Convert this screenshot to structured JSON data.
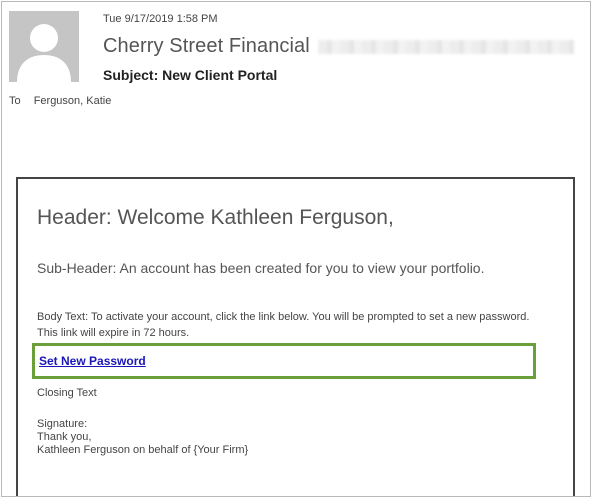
{
  "header": {
    "timestamp": "Tue 9/17/2019 1:58 PM",
    "sender_name": "Cherry Street Financial",
    "subject": "Subject: New Client Portal",
    "to_label": "To",
    "to_value": "Ferguson, Katie"
  },
  "email": {
    "header_text": "Header: Welcome Kathleen Ferguson,",
    "subheader_text": "Sub-Header: An account has been created for you to view your portfolio.",
    "body_text": "Body Text: To activate your account, click the link below. You will be prompted to set a new password. This link will expire in 72 hours.",
    "link_text": "Set New Password",
    "closing_text": "Closing Text",
    "signature": {
      "label": "Signature:",
      "line1": "Thank you,",
      "line2": "Kathleen Ferguson on behalf of {Your Firm}"
    }
  },
  "colors": {
    "highlight_border": "#6a9f3a",
    "link": "#1a16b8",
    "avatar_bg": "#c5c5c5"
  },
  "icons": {
    "avatar": "person-silhouette-icon"
  }
}
